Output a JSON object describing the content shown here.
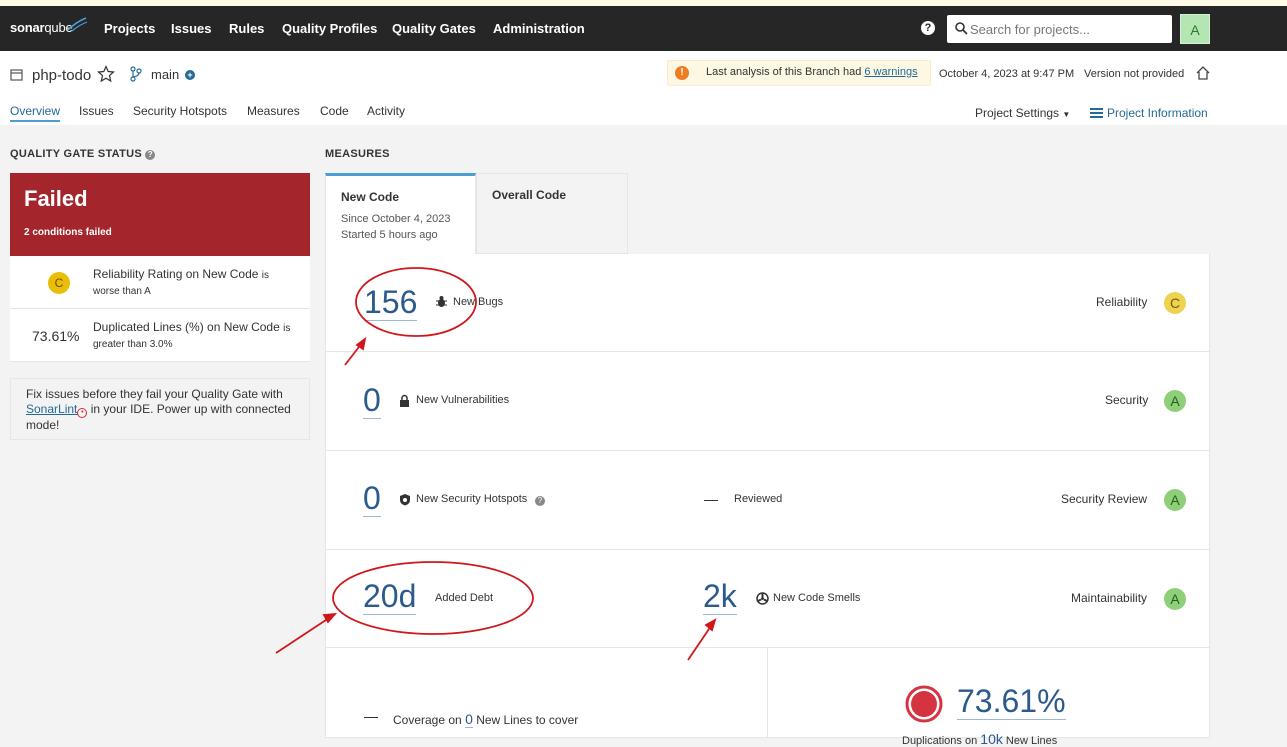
{
  "topbar": {
    "logo_bold": "sonar",
    "logo_light": "qube",
    "nav": [
      "Projects",
      "Issues",
      "Rules",
      "Quality Profiles",
      "Quality Gates",
      "Administration"
    ],
    "search_placeholder": "Search for projects...",
    "avatar_letter": "A"
  },
  "project": {
    "name": "php-todo",
    "branch": "main",
    "warning_prefix": "Last analysis of this Branch had ",
    "warning_link": "6 warnings",
    "date": "October 4, 2023 at 9:47 PM",
    "version": "Version not provided",
    "tabs": [
      "Overview",
      "Issues",
      "Security Hotspots",
      "Measures",
      "Code",
      "Activity"
    ],
    "settings_label": "Project Settings",
    "info_label": "Project Information"
  },
  "quality_gate": {
    "section_title": "QUALITY GATE STATUS",
    "status": "Failed",
    "conditions_failed": "2 conditions failed",
    "conditions": [
      {
        "rating": "C",
        "text": "Reliability Rating on New Code",
        "detail_is": "is",
        "detail": "worse than A"
      },
      {
        "value": "73.61%",
        "text": "Duplicated Lines (%) on New Code",
        "detail_is": "is",
        "detail": "greater than 3.0%"
      }
    ],
    "sonarlint_pre": "Fix issues before they fail your Quality Gate with",
    "sonarlint_link": "SonarLint",
    "sonarlint_post": "in your IDE. Power up with connected mode!"
  },
  "measures": {
    "section_title": "MEASURES",
    "tab_new": "New Code",
    "tab_new_since": "Since October 4, 2023",
    "tab_new_started": "Started 5 hours ago",
    "tab_overall": "Overall Code",
    "bugs": {
      "value": "156",
      "label": "New Bugs",
      "category": "Reliability",
      "rating": "C"
    },
    "vulns": {
      "value": "0",
      "label": "New Vulnerabilities",
      "category": "Security",
      "rating": "A"
    },
    "hotspots": {
      "value": "0",
      "label": "New Security Hotspots",
      "reviewed_label": "Reviewed",
      "category": "Security Review",
      "rating": "A"
    },
    "debt": {
      "value": "20d",
      "label": "Added Debt",
      "smells_value": "2k",
      "smells_label": "New Code Smells",
      "category": "Maintainability",
      "rating": "A"
    },
    "coverage": {
      "prefix": "Coverage on",
      "value": "0",
      "suffix": "New Lines to cover"
    },
    "duplication": {
      "value": "73.61%",
      "sub_prefix": "Duplications on",
      "sub_value": "10k",
      "sub_suffix": "New Lines"
    }
  },
  "colors": {
    "failed": "#a4262c",
    "accent": "#236a97",
    "rating_a": "#8fcf7a",
    "rating_c": "#eed251",
    "annotation": "#d0171b"
  }
}
